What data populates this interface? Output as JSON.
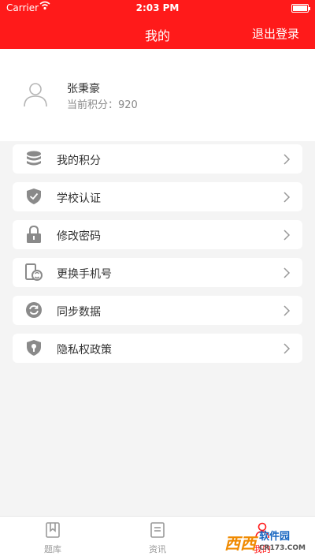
{
  "status_bar": {
    "carrier": "Carrier",
    "time": "2:03 PM"
  },
  "navbar": {
    "title": "我的",
    "logout_label": "退出登录"
  },
  "profile": {
    "name": "张秉豪",
    "points_label": "当前积分：",
    "points_value": "920"
  },
  "menu": [
    {
      "label": "我的积分",
      "icon": "database-icon"
    },
    {
      "label": "学校认证",
      "icon": "shield-check-icon"
    },
    {
      "label": "修改密码",
      "icon": "lock-icon"
    },
    {
      "label": "更换手机号",
      "icon": "phone-switch-icon"
    },
    {
      "label": "同步数据",
      "icon": "sync-icon"
    },
    {
      "label": "隐私权政策",
      "icon": "privacy-shield-icon"
    }
  ],
  "tabbar": {
    "tabs": [
      {
        "label": "题库"
      },
      {
        "label": "资讯"
      },
      {
        "label": "我的"
      }
    ]
  },
  "watermark": {
    "brand": "西西",
    "site": "软件园",
    "url": "CR173.COM"
  },
  "colors": {
    "accent": "#ff1a1a",
    "background": "#f4f4f4",
    "icon_gray": "#8a8a8a"
  }
}
